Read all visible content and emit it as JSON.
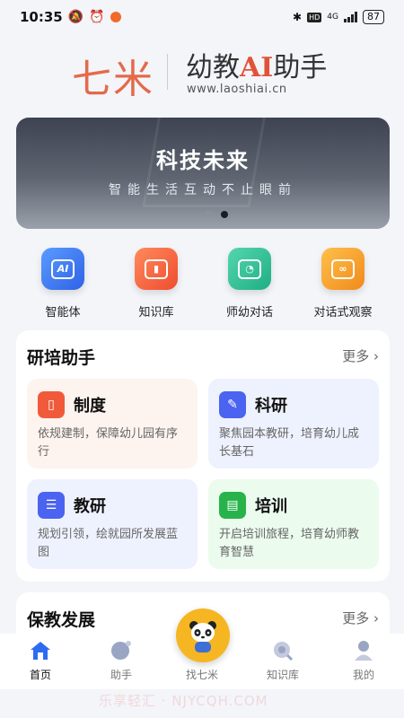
{
  "status_bar": {
    "time": "10:35",
    "network": "4G",
    "battery": "87"
  },
  "brand": {
    "logo_cn": "七米",
    "title_prefix": "幼教",
    "title_ai": "AI",
    "title_suffix": "助手",
    "url": "www.laoshiai.cn"
  },
  "banner": {
    "title": "科技未来",
    "subtitle": "智能生活互动不止眼前",
    "slide_index": 2,
    "slide_count": 2
  },
  "quick_entries": [
    {
      "label": "智能体",
      "icon": "ai-agent-icon",
      "color": "#3d7cf2"
    },
    {
      "label": "知识库",
      "icon": "knowledge-base-icon",
      "color": "#f1643f"
    },
    {
      "label": "师幼对话",
      "icon": "dialogue-icon",
      "color": "#2fc096"
    },
    {
      "label": "对话式观察",
      "icon": "observe-icon",
      "color": "#f59b2b"
    }
  ],
  "section_research": {
    "title": "研培助手",
    "more": "更多",
    "cards": [
      {
        "title": "制度",
        "desc": "依规建制，保障幼儿园有序行",
        "icon": "rules-icon",
        "icon_color": "#f05a3a",
        "bg": "#fdf3ef"
      },
      {
        "title": "科研",
        "desc": "聚焦园本教研，培育幼儿成长基石",
        "icon": "research-icon",
        "icon_color": "#4a63f0",
        "bg": "#eef2fe"
      },
      {
        "title": "教研",
        "desc": "规划引领，绘就园所发展蓝图",
        "icon": "teaching-icon",
        "icon_color": "#4a63f0",
        "bg": "#eef2fe"
      },
      {
        "title": "培训",
        "desc": "开启培训旅程，培育幼师教育智慧",
        "icon": "training-icon",
        "icon_color": "#27b34a",
        "bg": "#ebfbee"
      }
    ]
  },
  "section_care": {
    "title": "保教发展",
    "more": "更多"
  },
  "tabbar": {
    "items": [
      {
        "label": "首页",
        "icon": "home-icon",
        "active": true
      },
      {
        "label": "助手",
        "icon": "assistant-icon",
        "active": false
      },
      {
        "label": "找七米",
        "icon": "panda-icon",
        "active": false
      },
      {
        "label": "知识库",
        "icon": "knowledge-icon",
        "active": false
      },
      {
        "label": "我的",
        "icon": "profile-icon",
        "active": false
      }
    ]
  },
  "watermark": "乐享轻汇 · NJYCQH.COM"
}
